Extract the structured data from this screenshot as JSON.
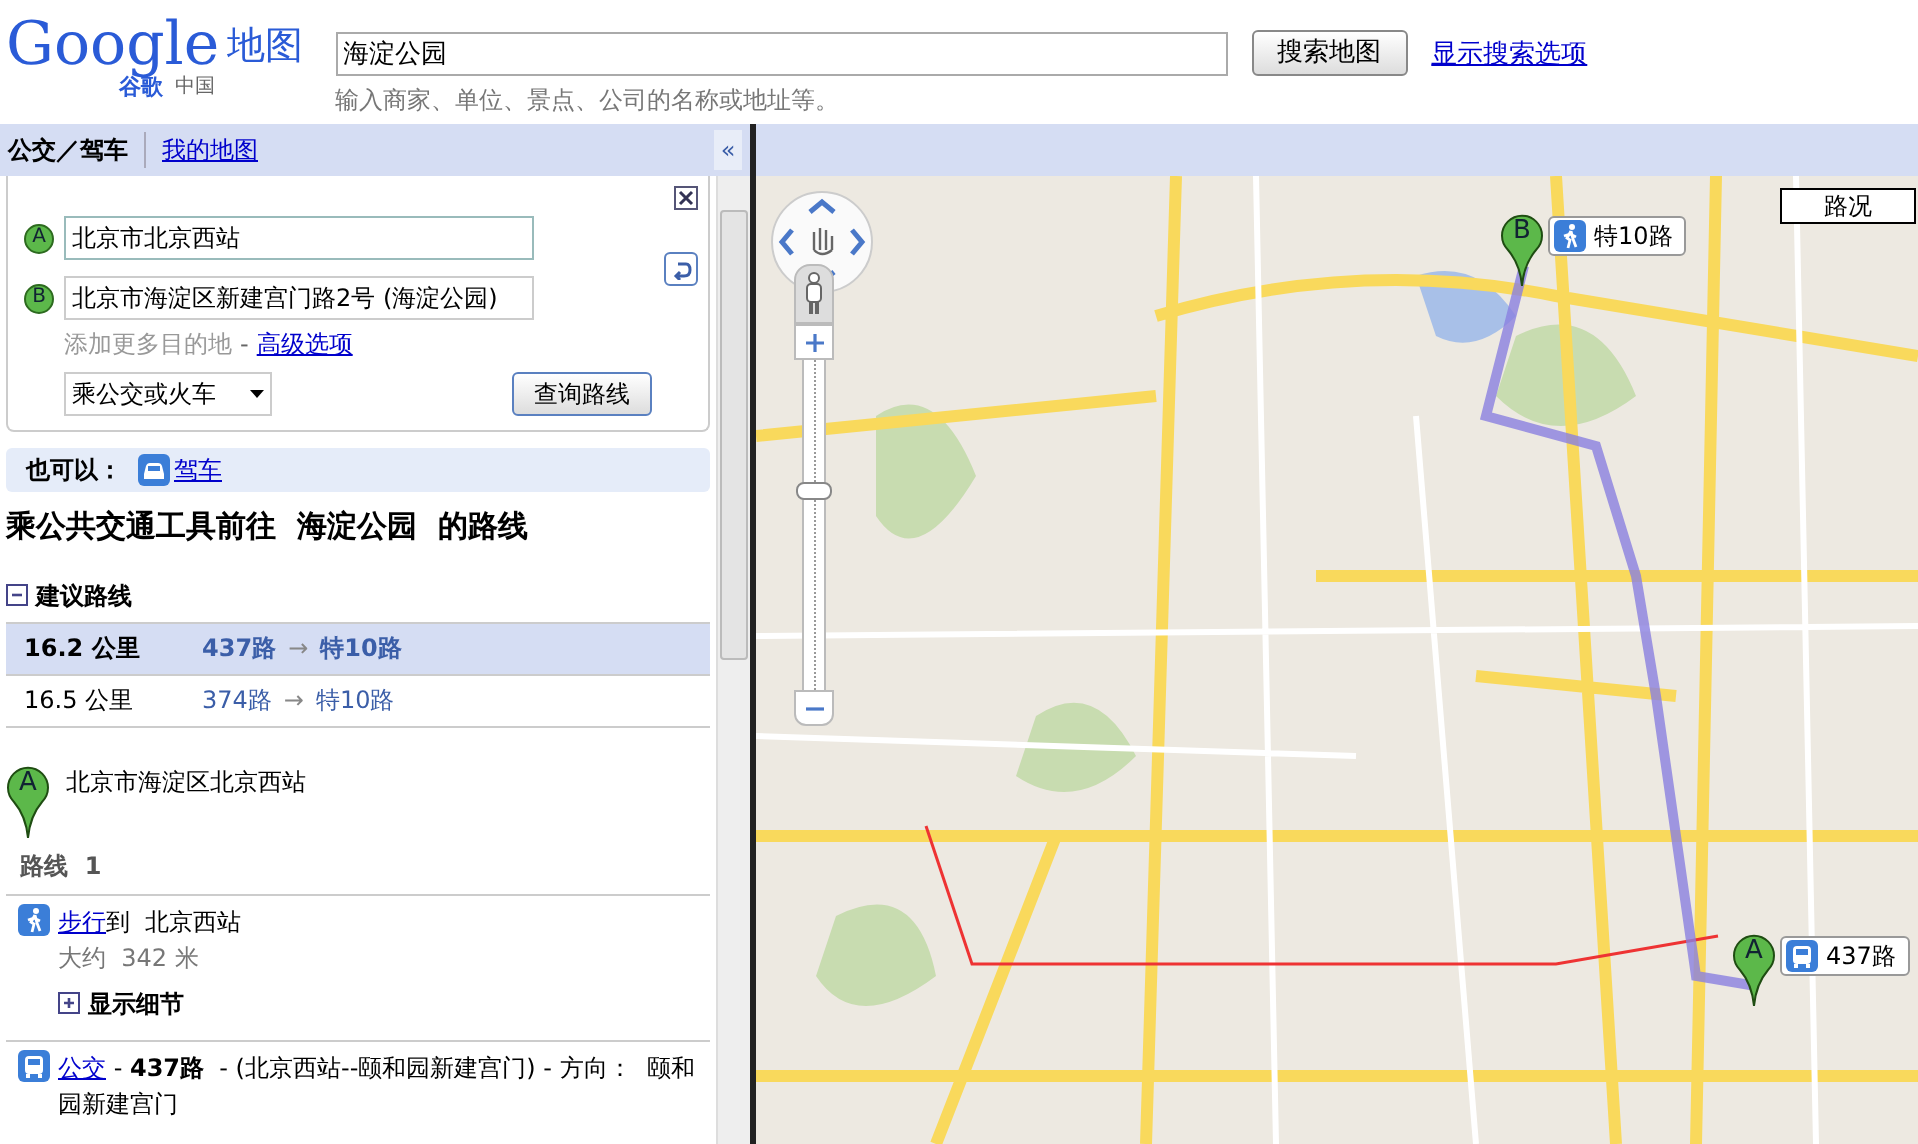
{
  "header": {
    "logo": {
      "wordmark": "Google",
      "sub_cn": "谷歌",
      "region": "中国",
      "product": "地图"
    },
    "search": {
      "value": "海淀公园",
      "hint": "输入商家、单位、景点、公司的名称或地址等。"
    },
    "search_button": "搜索地图",
    "options_link": "显示搜索选项"
  },
  "sidebar": {
    "tabs": [
      {
        "label": "公交／驾车",
        "selected": true
      },
      {
        "label": "我的地图",
        "selected": false
      }
    ],
    "collapse": "«",
    "form": {
      "start": {
        "badge": "A",
        "value": "北京市北京西站"
      },
      "end": {
        "badge": "B",
        "value": "北京市海淀区新建宫门路2号 (海淀公园)"
      },
      "add_destination": "添加更多目的地",
      "advanced_prefix": "-",
      "advanced_link": "高级选项",
      "mode": "乘公交或火车",
      "submit": "查询路线"
    },
    "also": {
      "label": "也可以：",
      "link": "驾车"
    },
    "title": "乘公共交通工具前往  海淀公园  的路线",
    "suggested": {
      "label": "建议路线",
      "expanded": true,
      "routes": [
        {
          "distance": "16.2 公里",
          "first": "437路",
          "arrow": "→",
          "second": "特10路",
          "selected": true
        },
        {
          "distance": "16.5 公里",
          "first": "374路",
          "arrow": "→",
          "second": "特10路",
          "selected": false
        }
      ]
    },
    "start_point": {
      "badge": "A",
      "address": "北京市海淀区北京西站"
    },
    "route_label": "路线  1",
    "steps": [
      {
        "kind": "walk",
        "link": "步行",
        "text": "到  北京西站",
        "detail": "大约  342 米",
        "toggle": "显示细节",
        "expanded": false
      },
      {
        "kind": "bus",
        "link": "公交",
        "text": " - **437路**  - (北京西站--颐和园新建宫门) - 方向：  颐和园新建宫门"
      }
    ]
  },
  "map": {
    "zoom": {
      "level": 0.6
    },
    "traffic_button": "路况",
    "markers": [
      {
        "badge": "B",
        "label": "特10路",
        "kind": "walk"
      },
      {
        "badge": "A",
        "label": "437路",
        "kind": "bus"
      }
    ]
  }
}
